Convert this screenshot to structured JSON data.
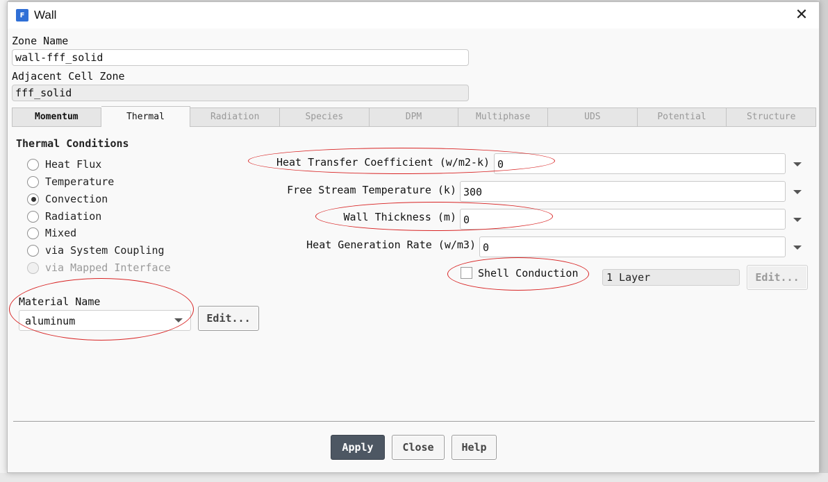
{
  "window": {
    "title": "Wall",
    "app_icon": "fluent-app-icon",
    "close_icon": "close-icon"
  },
  "zone": {
    "name_label": "Zone Name",
    "name_value": "wall-fff_solid",
    "adjacent_label": "Adjacent Cell Zone",
    "adjacent_value": "fff_solid"
  },
  "tabs": [
    {
      "label": "Momentum",
      "active": false
    },
    {
      "label": "Thermal",
      "active": true
    },
    {
      "label": "Radiation",
      "active": false
    },
    {
      "label": "Species",
      "active": false
    },
    {
      "label": "DPM",
      "active": false
    },
    {
      "label": "Multiphase",
      "active": false
    },
    {
      "label": "UDS",
      "active": false
    },
    {
      "label": "Potential",
      "active": false
    },
    {
      "label": "Structure",
      "active": false
    }
  ],
  "thermal": {
    "section_title": "Thermal Conditions",
    "options": [
      {
        "label": "Heat Flux",
        "checked": false,
        "enabled": true
      },
      {
        "label": "Temperature",
        "checked": false,
        "enabled": true
      },
      {
        "label": "Convection",
        "checked": true,
        "enabled": true
      },
      {
        "label": "Radiation",
        "checked": false,
        "enabled": true
      },
      {
        "label": "Mixed",
        "checked": false,
        "enabled": true
      },
      {
        "label": "via System Coupling",
        "checked": false,
        "enabled": true
      },
      {
        "label": "via Mapped Interface",
        "checked": false,
        "enabled": false
      }
    ],
    "material": {
      "label": "Material Name",
      "value": "aluminum",
      "edit_label": "Edit..."
    },
    "fields": {
      "htc": {
        "label": "Heat Transfer Coefficient (w/m2-k)",
        "value": "0"
      },
      "free_stream": {
        "label": "Free Stream Temperature (k)",
        "value": "300"
      },
      "thickness": {
        "label": "Wall Thickness (m)",
        "value": "0"
      },
      "heat_gen": {
        "label": "Heat Generation Rate (w/m3)",
        "value": "0"
      }
    },
    "shell": {
      "label": "Shell Conduction",
      "checked": false,
      "layers_value": "1 Layer",
      "edit_label": "Edit..."
    }
  },
  "buttons": {
    "apply": "Apply",
    "close": "Close",
    "help": "Help"
  },
  "colors": {
    "annotation": "#d82424",
    "apply_bg": "#4d5763"
  }
}
